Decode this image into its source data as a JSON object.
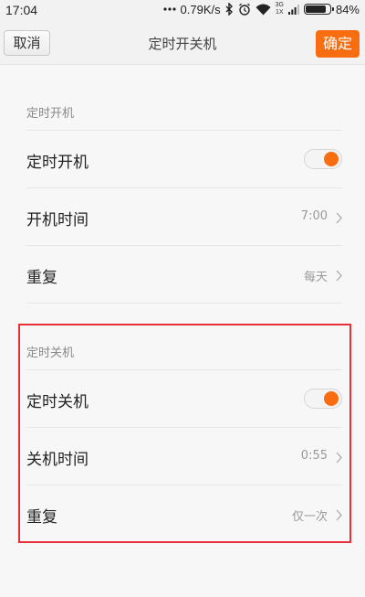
{
  "status_bar": {
    "time": "17:04",
    "net_speed": "0.79K/s",
    "net_type_top": "3G",
    "net_type_bottom": "1X",
    "battery": "84%",
    "battery_level": 0.84
  },
  "header": {
    "cancel_label": "取消",
    "title": "定时开关机",
    "confirm_label": "确定"
  },
  "power_on": {
    "section_title": "定时开机",
    "toggle_label": "定时开机",
    "toggle_on": true,
    "time_label": "开机时间",
    "time_value": "7:00",
    "repeat_label": "重复",
    "repeat_value": "每天"
  },
  "power_off": {
    "section_title": "定时关机",
    "toggle_label": "定时关机",
    "toggle_on": true,
    "time_label": "关机时间",
    "time_value": "0:55",
    "repeat_label": "重复",
    "repeat_value": "仅一次"
  },
  "colors": {
    "accent": "#f76d10",
    "highlight": "#e8303a"
  }
}
